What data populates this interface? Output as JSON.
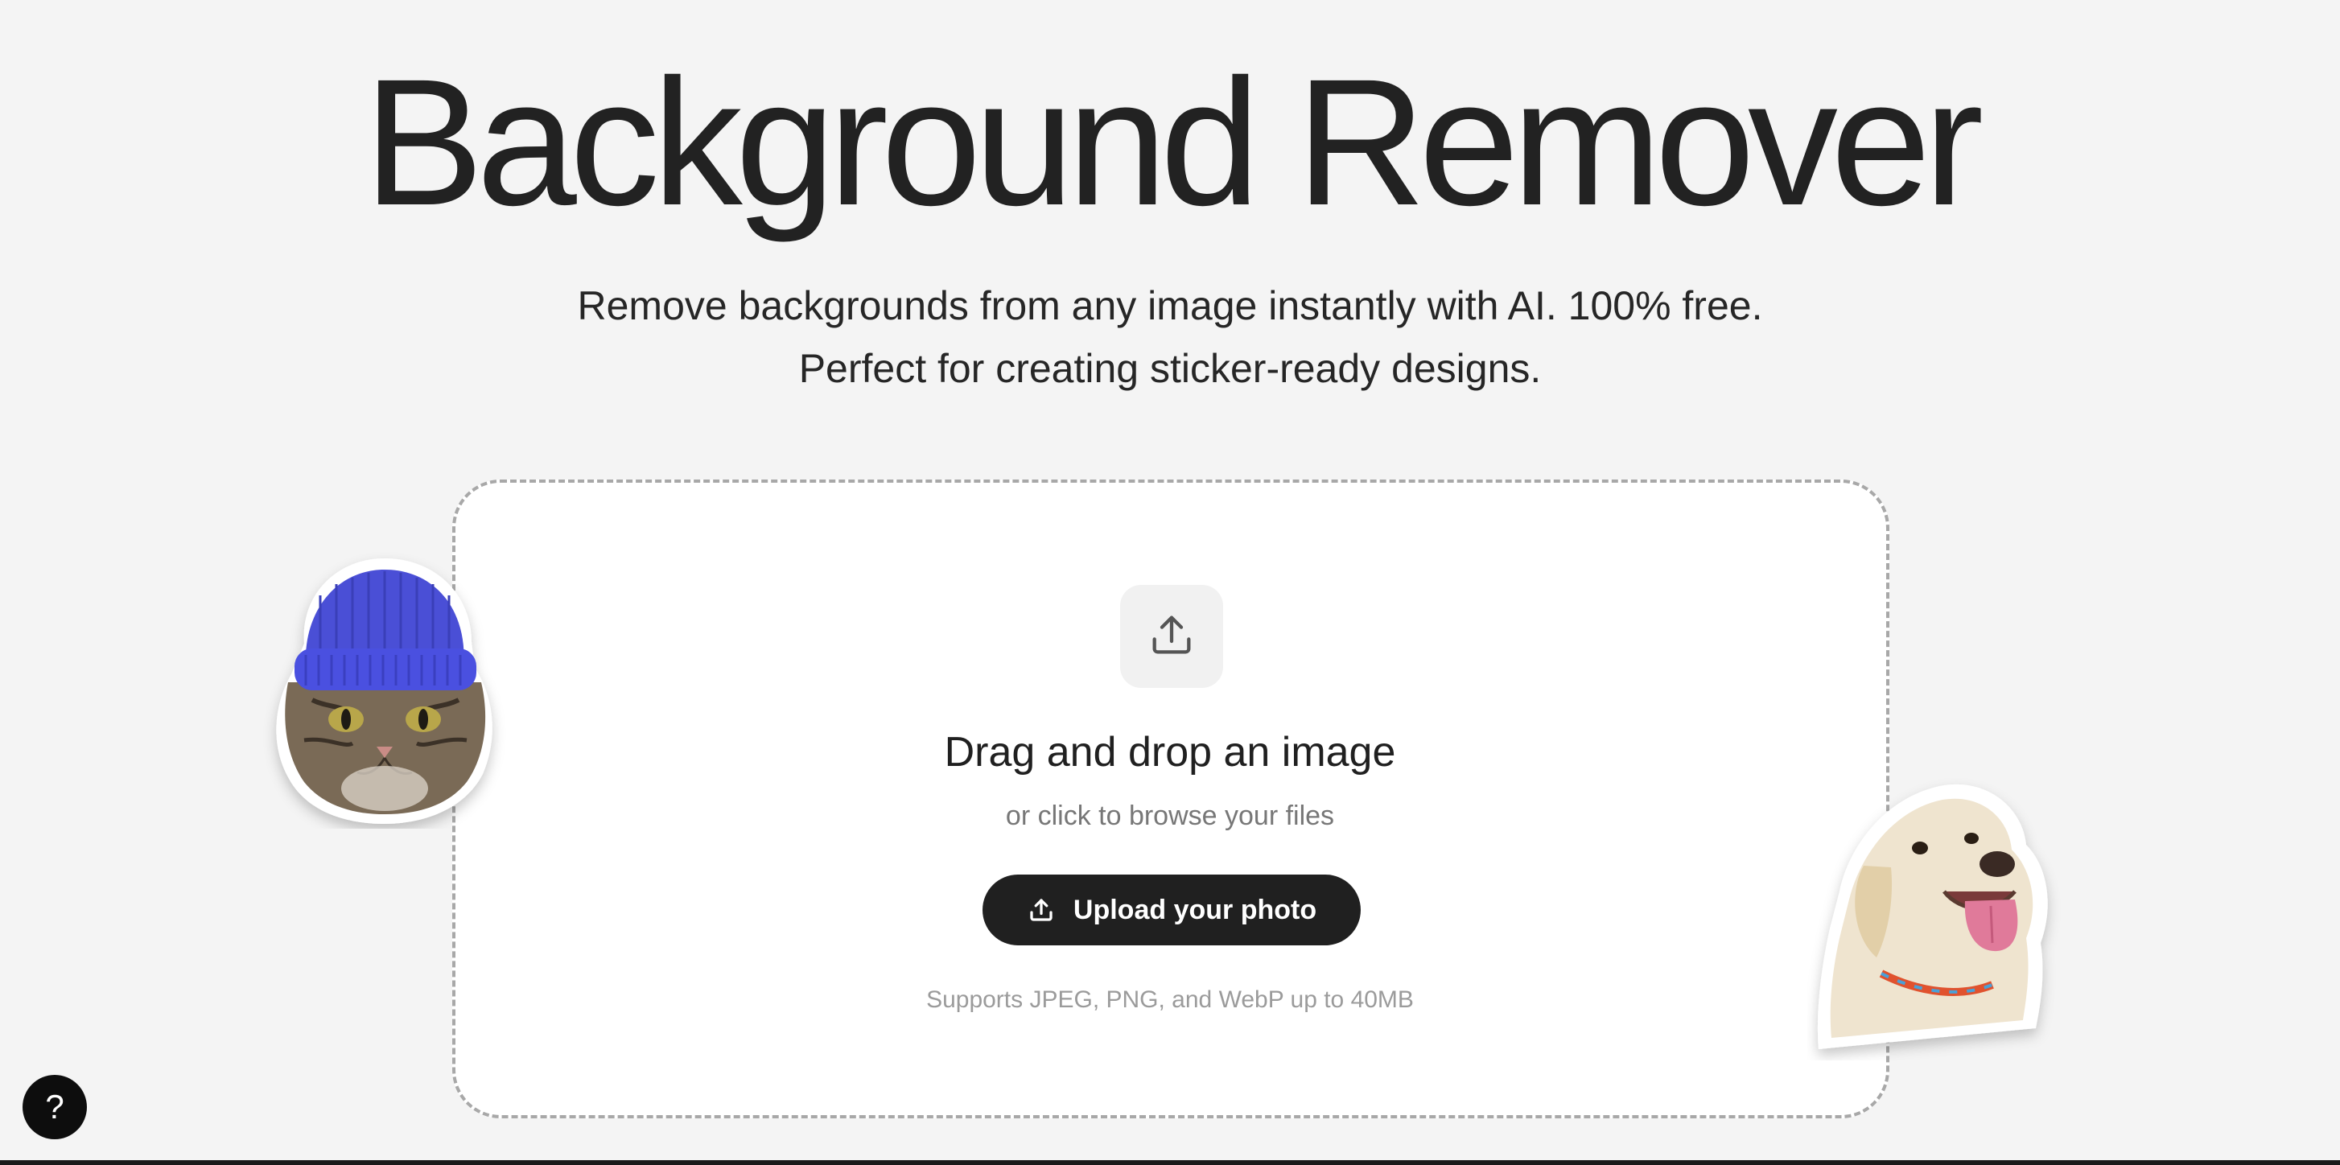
{
  "hero": {
    "title": "Background Remover",
    "subtitle_line1": "Remove backgrounds from any image instantly with AI. 100% free.",
    "subtitle_line2": "Perfect for creating sticker-ready designs."
  },
  "dropzone": {
    "icon": "upload-icon",
    "heading": "Drag and drop an image",
    "subheading": "or click to browse your files",
    "button_label": "Upload your photo",
    "button_icon": "upload-icon",
    "note": "Supports JPEG, PNG, and WebP up to 40MB"
  },
  "stickers": [
    {
      "subject": "cat-wearing-blue-beanie"
    },
    {
      "subject": "labrador-dog"
    }
  ],
  "help": {
    "label": "?"
  },
  "colors": {
    "background": "#f4f4f4",
    "button": "#202020",
    "dropzone_border": "#a8a8a8",
    "beanie": "#4a4fd6"
  }
}
